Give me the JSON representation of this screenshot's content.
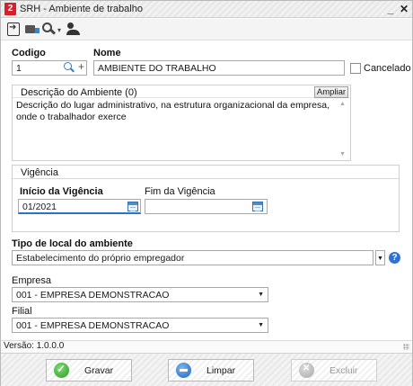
{
  "window": {
    "title": "SRH - Ambiente de trabalho",
    "app_logo_letter": "2",
    "minimize_glyph": "_",
    "close_glyph": "✕"
  },
  "toolbar": {
    "icons": [
      "exit-icon",
      "id-card-icon",
      "search-icon",
      "user-icon"
    ],
    "search_caret": "▾"
  },
  "form": {
    "codigo_label": "Codigo",
    "codigo_value": "1",
    "plus_glyph": "+",
    "nome_label": "Nome",
    "nome_value": "AMBIENTE DO TRABALHO",
    "cancelado_label": "Cancelado"
  },
  "descricao": {
    "label": "Descrição do Ambiente (0)",
    "ampliar_label": "Ampliar",
    "text": "Descrição do lugar administrativo, na estrutura organizacional da empresa, onde o trabalhador exerce",
    "scroll_up": "▲",
    "scroll_down": "▼"
  },
  "vigencia": {
    "group_label": "Vigência",
    "inicio_label": "Início da Vigência",
    "inicio_value": "01/2021",
    "fim_label": "Fim da Vigência",
    "fim_value": ""
  },
  "tipo_local": {
    "label": "Tipo de local do ambiente",
    "value": "Estabelecimento do próprio empregador",
    "arrow": "▼",
    "help_glyph": "?"
  },
  "empresa": {
    "label": "Empresa",
    "value": "001 - EMPRESA DEMONSTRACAO",
    "arrow": "▼"
  },
  "filial": {
    "label": "Filial",
    "value": "001 - EMPRESA DEMONSTRACAO",
    "arrow": "▼"
  },
  "status": {
    "version": "Versão:  1.0.0.0"
  },
  "buttons": {
    "gravar": "Gravar",
    "limpar": "Limpar",
    "excluir": "Excluir"
  },
  "colors": {
    "accent": "#2e73cf",
    "logo": "#d9202a",
    "ok": "#2e9a2a"
  }
}
